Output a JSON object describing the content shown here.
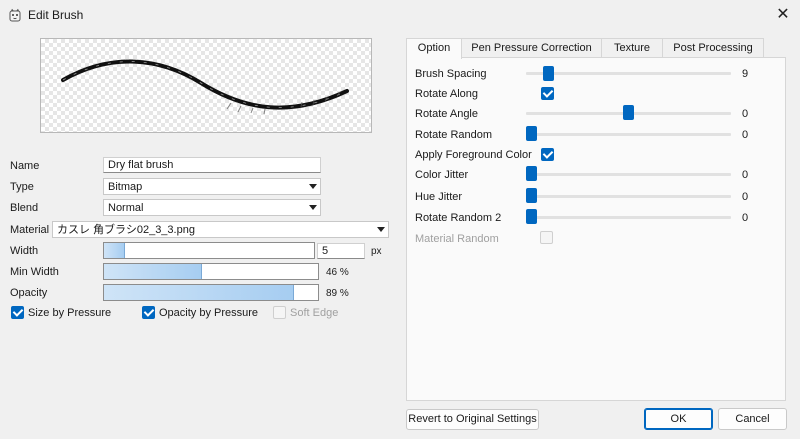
{
  "window": {
    "title": "Edit Brush",
    "close_glyph": "✕",
    "app_icon": "brush-app-icon"
  },
  "form": {
    "name_label": "Name",
    "name_value": "Dry flat brush",
    "type_label": "Type",
    "type_value": "Bitmap",
    "blend_label": "Blend",
    "blend_value": "Normal",
    "material_label": "Material",
    "material_value": "カスレ 角ブラシ02_3_3.png",
    "width_label": "Width",
    "width_value": "5",
    "width_unit": "px",
    "width_fill": 0.1,
    "min_width_label": "Min Width",
    "min_width_value": "46",
    "min_width_unit": "%",
    "min_width_fill": 0.46,
    "opacity_label": "Opacity",
    "opacity_value": "89",
    "opacity_unit": "%",
    "opacity_fill": 0.89,
    "size_by_pressure_label": "Size by Pressure",
    "size_by_pressure_checked": true,
    "opacity_by_pressure_label": "Opacity by Pressure",
    "opacity_by_pressure_checked": true,
    "soft_edge_label": "Soft Edge",
    "soft_edge_checked": false
  },
  "tabs": [
    {
      "label": "Option",
      "active": true
    },
    {
      "label": "Pen Pressure Correction",
      "active": false
    },
    {
      "label": "Texture",
      "active": false
    },
    {
      "label": "Post Processing",
      "active": false
    }
  ],
  "options": {
    "brush_spacing_label": "Brush Spacing",
    "brush_spacing_value": "9",
    "brush_spacing_pos": 0.09,
    "rotate_along_label": "Rotate Along",
    "rotate_along_checked": true,
    "rotate_angle_label": "Rotate Angle",
    "rotate_angle_value": "0",
    "rotate_angle_pos": 0.5,
    "rotate_random_label": "Rotate Random",
    "rotate_random_value": "0",
    "rotate_random_pos": 0,
    "apply_fg_color_label": "Apply Foreground Color",
    "apply_fg_color_checked": true,
    "color_jitter_label": "Color Jitter",
    "color_jitter_value": "0",
    "color_jitter_pos": 0,
    "hue_jitter_label": "Hue Jitter",
    "hue_jitter_value": "0",
    "hue_jitter_pos": 0,
    "rotate_random2_label": "Rotate Random 2",
    "rotate_random2_value": "0",
    "rotate_random2_pos": 0,
    "material_random_label": "Material Random",
    "material_random_checked": false
  },
  "buttons": {
    "revert": "Revert to Original Settings",
    "ok": "OK",
    "cancel": "Cancel"
  },
  "colors": {
    "accent": "#0067c0",
    "bar_fill": "#a6cdf1"
  }
}
